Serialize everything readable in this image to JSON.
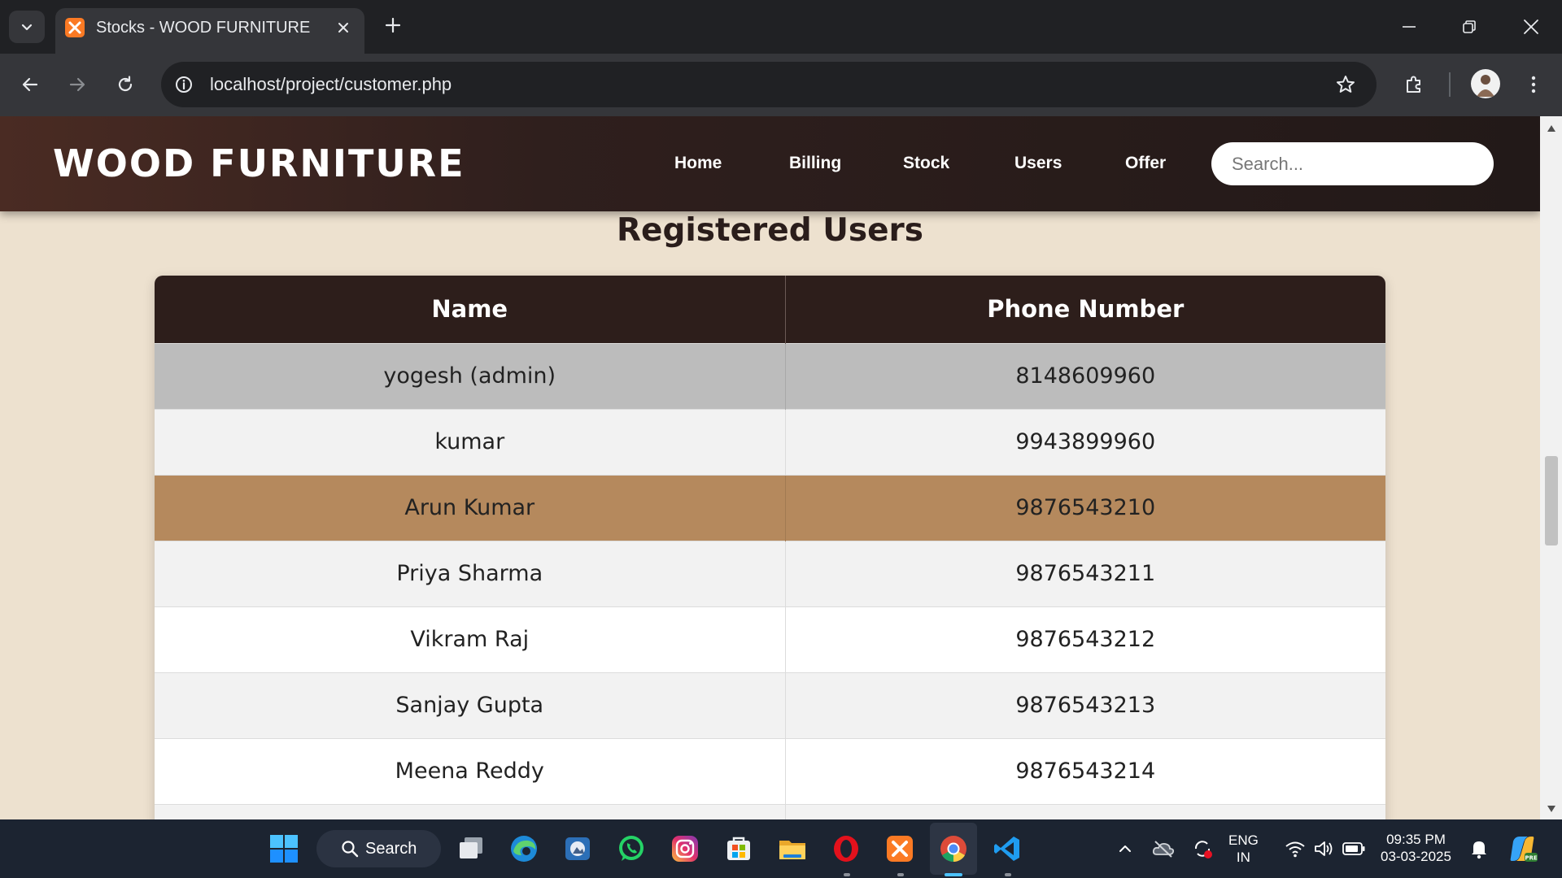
{
  "browser": {
    "tab_title": "Stocks - WOOD FURNITURE",
    "url": "localhost/project/customer.php"
  },
  "site": {
    "brand": "WOOD FURNITURE",
    "nav": [
      "Home",
      "Billing",
      "Stock",
      "Users",
      "Offer"
    ],
    "search_placeholder": "Search..."
  },
  "main": {
    "title": "Registered Users",
    "columns": [
      "Name",
      "Phone Number"
    ],
    "rows": [
      {
        "name": "yogesh (admin)",
        "phone": "8148609960",
        "state": "selected"
      },
      {
        "name": "kumar",
        "phone": "9943899960",
        "state": "normal"
      },
      {
        "name": "Arun Kumar",
        "phone": "9876543210",
        "state": "hover"
      },
      {
        "name": "Priya Sharma",
        "phone": "9876543211",
        "state": "normal"
      },
      {
        "name": "Vikram Raj",
        "phone": "9876543212",
        "state": "normal"
      },
      {
        "name": "Sanjay Gupta",
        "phone": "9876543213",
        "state": "normal"
      },
      {
        "name": "Meena Reddy",
        "phone": "9876543214",
        "state": "normal"
      },
      {
        "name": "",
        "phone": "",
        "state": "normal"
      }
    ]
  },
  "taskbar": {
    "search_label": "Search",
    "language_line1": "ENG",
    "language_line2": "IN",
    "time": "09:35 PM",
    "date": "03-03-2025",
    "apps": [
      "task-view-icon",
      "edge-icon",
      "photos-icon",
      "whatsapp-icon",
      "instagram-icon",
      "store-icon",
      "file-explorer-icon",
      "opera-icon",
      "xampp-icon",
      "chrome-icon",
      "vscode-icon"
    ]
  },
  "colors": {
    "header_start": "#4a2b23",
    "header_end": "#221918",
    "page_bg": "#ede1cf",
    "table_header": "#2d1e1b",
    "row_selected": "#bcbcbc",
    "row_hover": "#b5895d"
  }
}
